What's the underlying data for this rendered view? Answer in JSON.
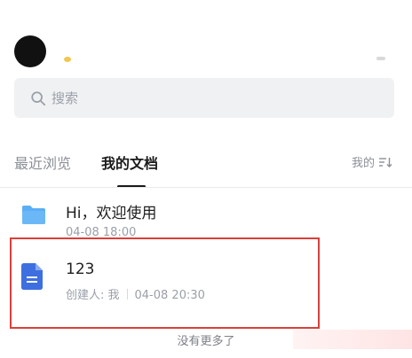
{
  "search": {
    "placeholder": "搜索"
  },
  "tabs": [
    {
      "label": "最近浏览",
      "active": false
    },
    {
      "label": "我的文档",
      "active": true
    }
  ],
  "sort": {
    "label": "我的",
    "icon": "sort-desc-icon"
  },
  "documents": [
    {
      "title": "Hi，欢迎使用",
      "icon": "folder-icon",
      "meta": "04-08 18:00"
    },
    {
      "title": "123",
      "icon": "document-icon",
      "creator": "创建人: 我",
      "meta": "04-08 20:30"
    }
  ],
  "footer": {
    "no_more": "没有更多了"
  },
  "colors": {
    "folder": "#5aaef5",
    "document": "#3d6fe0",
    "highlight": "#d9403a",
    "search_bg": "#f0f1f3"
  }
}
